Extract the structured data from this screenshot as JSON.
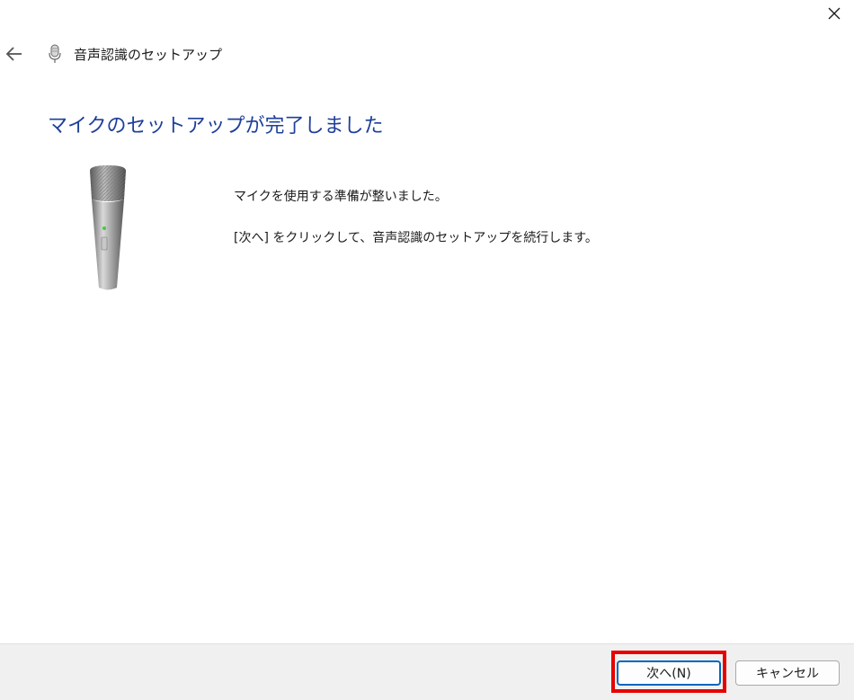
{
  "window": {
    "title": "音声認識のセットアップ",
    "close_icon": "close-icon",
    "back_icon": "back-arrow-icon",
    "title_icon": "microphone-icon"
  },
  "content": {
    "heading": "マイクのセットアップが完了しました",
    "lines": [
      "マイクを使用する準備が整いました。",
      "[次へ] をクリックして、音声認識のセットアップを続行します。"
    ],
    "illustration": "microphone-illustration"
  },
  "footer": {
    "next_label": "次へ(N)",
    "cancel_label": "キャンセル"
  },
  "colors": {
    "heading": "#1e3f9a",
    "highlight": "#e60000",
    "default_button_border": "#0067c0"
  }
}
